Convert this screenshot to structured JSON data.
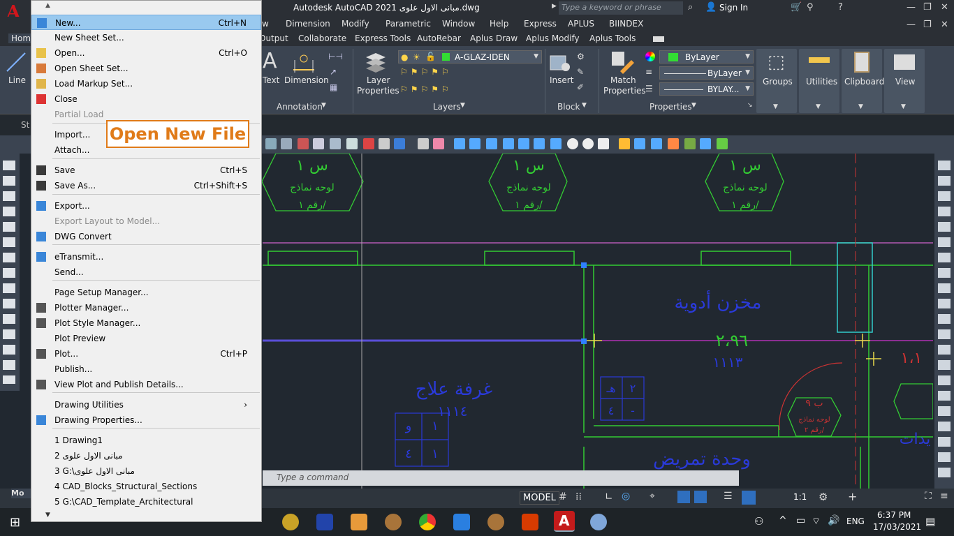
{
  "titlebar": {
    "title": "Autodesk AutoCAD 2021  مبانى الاول علوى.dwg",
    "search_placeholder": "Type a keyword or phrase",
    "sign_in": "Sign In"
  },
  "ribbon_tabs_row1": [
    "Home",
    "w",
    "Dimension",
    "Modify",
    "Parametric",
    "Window",
    "Help",
    "Express",
    "APLUS",
    "BIINDEX"
  ],
  "ribbon_tabs_row2": [
    "Output",
    "Collaborate",
    "Express Tools",
    "AutoRebar",
    "Aplus Draw",
    "Aplus Modify",
    "Aplus Tools"
  ],
  "ribbon": {
    "line": "Line",
    "text": "Text",
    "dimension": "Dimension",
    "annotation": "Annotation",
    "layer_properties_1": "Layer",
    "layer_properties_2": "Properties",
    "layer_name": "A-GLAZ-IDEN",
    "layers": "Layers",
    "insert": "Insert",
    "block": "Block",
    "match_1": "Match",
    "match_2": "Properties",
    "bylayer_color": "ByLayer",
    "bylayer_line": "ByLayer",
    "bylayer_weight": "BYLAY...",
    "properties": "Properties",
    "groups": "Groups",
    "utilities": "Utilities",
    "clipboard": "Clipboard",
    "view": "View"
  },
  "doctab_partial": "St",
  "model_tab_partial": "Mo",
  "command_placeholder": "Type a command",
  "status": {
    "model": "MODEL",
    "scale": "1:1"
  },
  "taskbar": {
    "lang": "ENG",
    "time": "6:37 PM",
    "date": "17/03/2021"
  },
  "app_menu": {
    "items": [
      {
        "label": "New...",
        "shortcut": "Ctrl+N",
        "state": "highlight"
      },
      {
        "label": "New Sheet Set...",
        "shortcut": ""
      },
      {
        "label": "Open...",
        "shortcut": "Ctrl+O"
      },
      {
        "label": "Open Sheet Set...",
        "shortcut": ""
      },
      {
        "label": "Load Markup Set...",
        "shortcut": ""
      },
      {
        "label": "Close",
        "shortcut": ""
      },
      {
        "label": "Partial Load",
        "shortcut": "",
        "state": "disabled"
      },
      {
        "label": "Import...",
        "shortcut": ""
      },
      {
        "label": "Attach...",
        "shortcut": ""
      },
      {
        "label": "Save",
        "shortcut": "Ctrl+S"
      },
      {
        "label": "Save As...",
        "shortcut": "Ctrl+Shift+S"
      },
      {
        "label": "Export...",
        "shortcut": ""
      },
      {
        "label": "Export Layout to Model...",
        "shortcut": "",
        "state": "disabled"
      },
      {
        "label": "DWG Convert",
        "shortcut": ""
      },
      {
        "label": "eTransmit...",
        "shortcut": ""
      },
      {
        "label": "Send...",
        "shortcut": ""
      },
      {
        "label": "Page Setup Manager...",
        "shortcut": ""
      },
      {
        "label": "Plotter Manager...",
        "shortcut": ""
      },
      {
        "label": "Plot Style Manager...",
        "shortcut": ""
      },
      {
        "label": "Plot Preview",
        "shortcut": ""
      },
      {
        "label": "Plot...",
        "shortcut": "Ctrl+P"
      },
      {
        "label": "Publish...",
        "shortcut": ""
      },
      {
        "label": "View Plot and Publish Details...",
        "shortcut": ""
      },
      {
        "label": "Drawing Utilities",
        "shortcut": "›"
      },
      {
        "label": "Drawing Properties...",
        "shortcut": ""
      },
      {
        "label": "1 Drawing1",
        "shortcut": ""
      },
      {
        "label": "2 مبانى الاول علوى",
        "shortcut": ""
      },
      {
        "label": "3 G:\\مبانى الاول علوى",
        "shortcut": ""
      },
      {
        "label": "4 CAD_Blocks_Structural_Sections",
        "shortcut": ""
      },
      {
        "label": "5 G:\\CAD_Template_Architectural",
        "shortcut": ""
      }
    ]
  },
  "annotation_callout": "Open New File",
  "drawing": {
    "room1": "مخزن أدوية",
    "room1_area": "٢،٩٦",
    "room1_num": "١١١٣",
    "room2": "غرفة علاج",
    "room2_num": "١١١٤",
    "room3": "وحدة تمريض",
    "hex_top": "س ١",
    "hex_line1": "لوحه نماذج",
    "hex_line2": "رقم ١/",
    "hex_b9": "ب ٩",
    "hex_b9_l1": "لوحه نماذج",
    "hex_b9_l2": "رقم ٢/",
    "box1_a": "و",
    "box1_b": "١",
    "box1_c": "٤",
    "box1_d": "١",
    "box2_a": "هـ",
    "box2_b": "٢",
    "box2_c": "٤",
    "box2_d": "-",
    "right_num": "١،١",
    "right_text": "يدات"
  },
  "colors": {
    "accent_red": "#d1161c",
    "highlight": "#99c9ef",
    "callout": "#e07b19",
    "green_line": "#33cc33",
    "blue_text": "#2a3ad8",
    "magenta": "#cc33cc"
  }
}
